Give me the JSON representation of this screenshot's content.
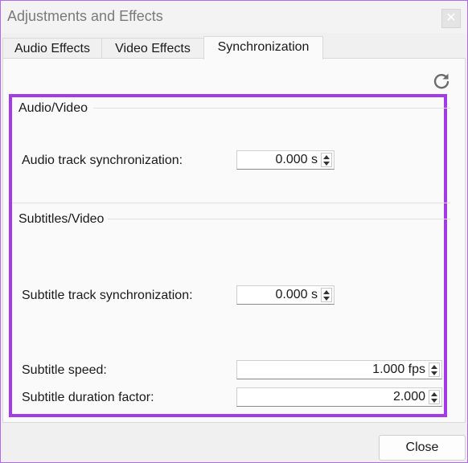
{
  "window": {
    "title": "Adjustments and Effects",
    "close_glyph": "✕"
  },
  "tabs": [
    {
      "label": "Audio Effects",
      "active": false
    },
    {
      "label": "Video Effects",
      "active": false
    },
    {
      "label": "Synchronization",
      "active": true
    }
  ],
  "reset_icon": "refresh-icon",
  "audio_video": {
    "group_title": "Audio/Video",
    "audio_sync": {
      "label": "Audio track synchronization:",
      "value": "0.000 s"
    }
  },
  "subtitles_video": {
    "group_title": "Subtitles/Video",
    "subtitle_sync": {
      "label": "Subtitle track synchronization:",
      "value": "0.000 s"
    },
    "subtitle_speed": {
      "label": "Subtitle speed:",
      "value": "1.000 fps"
    },
    "subtitle_duration": {
      "label": "Subtitle duration factor:",
      "value": "2.000"
    }
  },
  "footer": {
    "close_label": "Close"
  },
  "colors": {
    "highlight_border": "#a33ce8",
    "window_border": "#b26be8"
  }
}
